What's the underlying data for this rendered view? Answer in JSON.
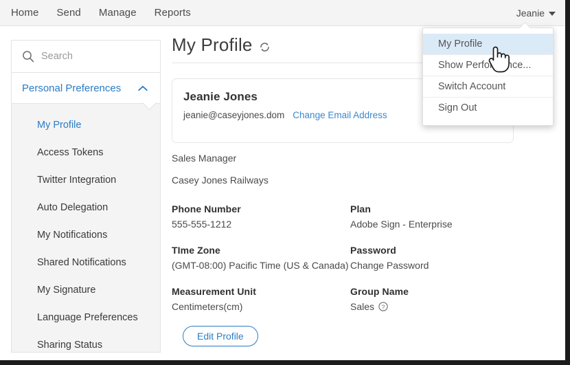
{
  "topnav": {
    "links": [
      {
        "label": "Home",
        "name": "nav-link-home"
      },
      {
        "label": "Send",
        "name": "nav-link-send"
      },
      {
        "label": "Manage",
        "name": "nav-link-manage"
      },
      {
        "label": "Reports",
        "name": "nav-link-reports"
      }
    ],
    "user": {
      "name_label": "Jeanie"
    }
  },
  "user_menu": {
    "items": [
      {
        "label": "My Profile",
        "active": true
      },
      {
        "label": "Show Performance...",
        "active": false
      },
      {
        "label": "Switch Account",
        "active": false
      },
      {
        "label": "Sign Out",
        "active": false
      }
    ]
  },
  "sidebar": {
    "search": {
      "placeholder": "Search",
      "value": "",
      "icon": "search-icon"
    },
    "section": {
      "label": "Personal Preferences",
      "expanded": true,
      "icon": "chevron-up-icon"
    },
    "items": [
      {
        "label": "My Profile",
        "selected": true
      },
      {
        "label": "Access Tokens",
        "selected": false
      },
      {
        "label": "Twitter Integration",
        "selected": false
      },
      {
        "label": "Auto Delegation",
        "selected": false
      },
      {
        "label": "My Notifications",
        "selected": false
      },
      {
        "label": "Shared Notifications",
        "selected": false
      },
      {
        "label": "My Signature",
        "selected": false
      },
      {
        "label": "Language Preferences",
        "selected": false
      },
      {
        "label": "Sharing Status",
        "selected": false
      }
    ]
  },
  "main": {
    "page_title": "My Profile",
    "refresh_icon": "refresh-icon",
    "card": {
      "name": "Jeanie Jones",
      "email": "jeanie@caseyjones.dom",
      "change_email_label": "Change Email Address",
      "job_title": "Sales Manager",
      "company": "Casey Jones Railways"
    },
    "details": [
      {
        "label": "Phone Number",
        "value": "555-555-1212",
        "type": "text"
      },
      {
        "label": "Plan",
        "value": "Adobe Sign - Enterprise",
        "type": "text"
      },
      {
        "label": "TIme Zone",
        "value": "(GMT-08:00) Pacific Time (US & Canada)",
        "type": "text"
      },
      {
        "label": "Password",
        "value": "Change Password",
        "type": "link"
      },
      {
        "label": "Measurement Unit",
        "value": "Centimeters(cm)",
        "type": "text"
      },
      {
        "label": "Group Name",
        "value": "Sales",
        "type": "help",
        "help_icon": "help-circle-icon"
      }
    ],
    "edit_button_label": "Edit Profile"
  },
  "colors": {
    "accent_blue": "#2b7cc4",
    "link_blue": "#3b87cc",
    "menu_highlight": "#dbeaf7",
    "panel_gray": "#f4f4f4",
    "border_gray": "#e3e3e3"
  },
  "cursor": {
    "icon": "hand-pointer-cursor"
  }
}
